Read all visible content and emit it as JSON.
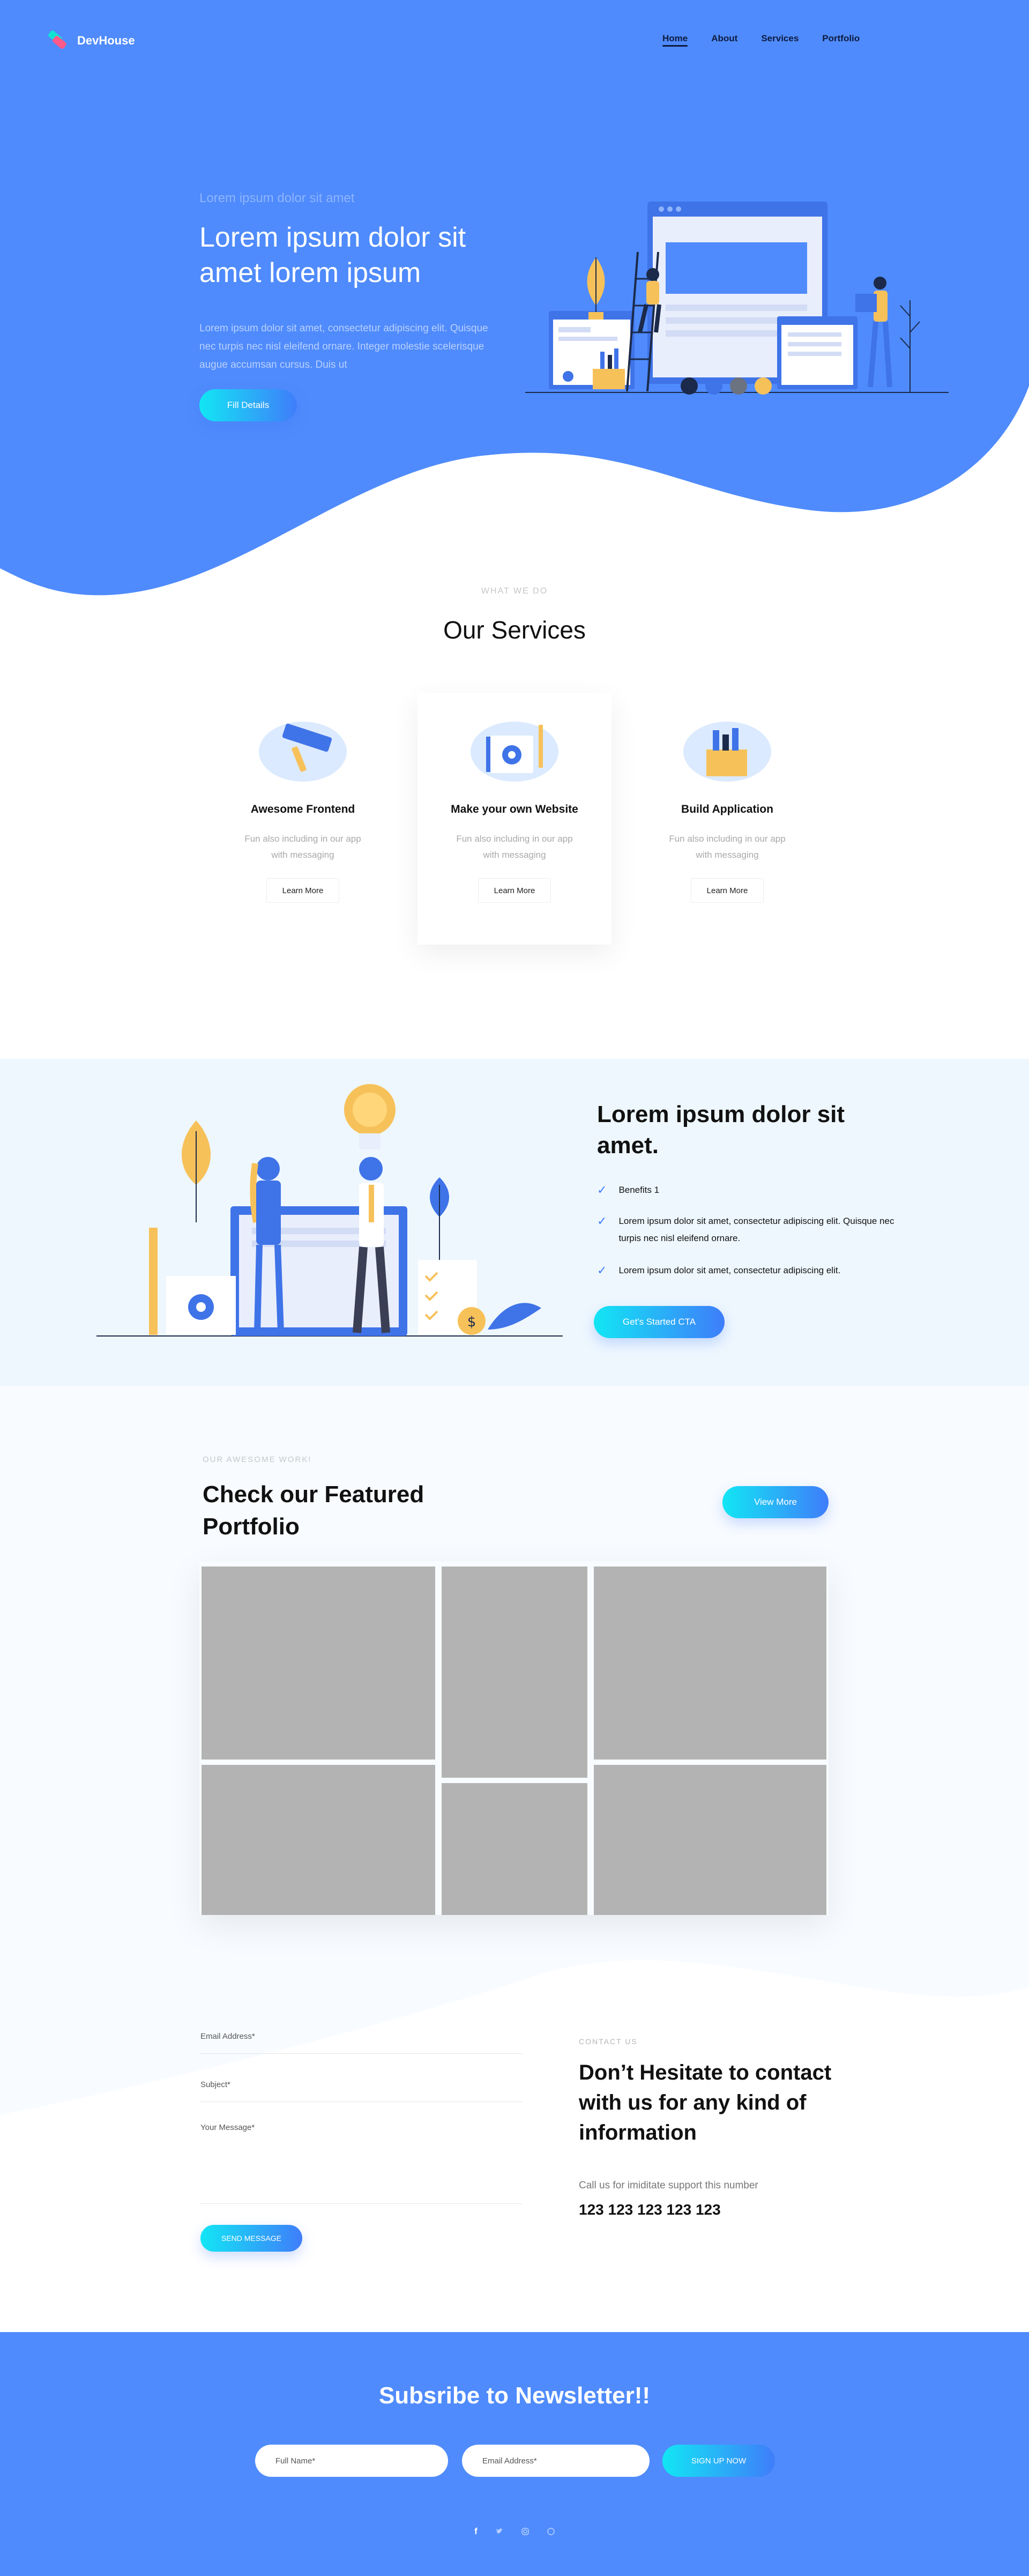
{
  "brand": {
    "name": "DevHouse"
  },
  "nav": {
    "items": [
      "Home",
      "About",
      "Services",
      "Portfolio"
    ]
  },
  "hero": {
    "eyebrow": "Lorem ipsum dolor sit amet",
    "title": "Lorem ipsum dolor sit amet lorem ipsum",
    "description": "Lorem ipsum dolor sit amet, consectetur adipiscing elit. Quisque nec turpis nec nisl eleifend ornare. Integer molestie scelerisque augue accumsan cursus. Duis ut",
    "button": "Fill Details"
  },
  "services": {
    "eyebrow": "WHAT WE DO",
    "title": "Our Services",
    "cards": [
      {
        "title": "Awesome Frontend",
        "text": "Fun also including in our app with messaging",
        "button": "Learn More",
        "icon": "paint-roller-icon"
      },
      {
        "title": "Make your own Website",
        "text": "Fun also including in our app with messaging",
        "button": "Learn More",
        "icon": "website-settings-icon"
      },
      {
        "title": "Build Application",
        "text": "Fun also including in our app with messaging",
        "button": "Learn More",
        "icon": "toolbox-icon"
      }
    ]
  },
  "benefits": {
    "title": "Lorem ipsum dolor sit amet.",
    "items": [
      "Benefits 1",
      "Lorem ipsum dolor sit amet, consectetur adipiscing elit. Quisque nec turpis nec nisl eleifend ornare.",
      "Lorem ipsum dolor sit amet, consectetur adipiscing elit."
    ],
    "button": "Get's Started CTA"
  },
  "portfolio": {
    "eyebrow": "OUR AWESOME WORK!",
    "title": "Check our Featured Portfolio",
    "button": "View More"
  },
  "contact": {
    "fields": {
      "email": "Email Address*",
      "subject": "Subject*",
      "message": "Your Message*"
    },
    "submit": "SEND MESSAGE",
    "eyebrow": "CONTACT US",
    "title": "Don’t Hesitate to contact with us for any kind of information",
    "support_text": "Call us for imiditate support this number",
    "phone": "123 123 123 123 123"
  },
  "newsletter": {
    "title": "Subsribe to Newsletter!!",
    "name_placeholder": "Full Name*",
    "email_placeholder": "Email Address*",
    "button": "SIGN UP NOW"
  },
  "social": [
    "facebook-icon",
    "twitter-icon",
    "instagram-icon",
    "dribbble-icon"
  ],
  "colors": {
    "primary": "#4f8bfc",
    "gradient_start": "#12e6f4",
    "gradient_end": "#3f7dfa",
    "light_section": "#eef7fe",
    "tile": "#b3b3b3",
    "yellow": "#f7c15a"
  }
}
